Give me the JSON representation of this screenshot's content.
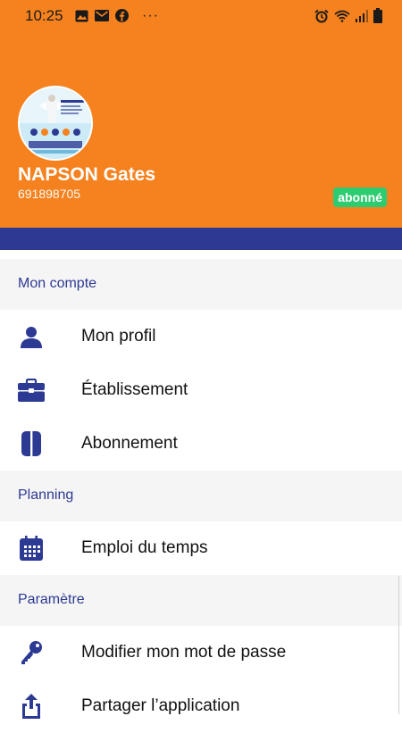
{
  "status_bar": {
    "time": "10:25",
    "more": "···",
    "left_icons": [
      "image-icon",
      "mail-icon",
      "facebook-icon"
    ],
    "right_icons": [
      "alarm-icon",
      "wifi-icon",
      "signal-icon",
      "battery-icon"
    ]
  },
  "profile": {
    "name": "NAPSON Gates",
    "phone": "691898705",
    "badge": "abonné"
  },
  "colors": {
    "accent": "#f5821f",
    "primary": "#2d3a93",
    "badge": "#2ecc71"
  },
  "menu": {
    "account": {
      "title": "Mon compte",
      "items": [
        {
          "label": "Mon profil",
          "icon": "person-icon"
        },
        {
          "label": "Établissement",
          "icon": "briefcase-icon"
        },
        {
          "label": "Abonnement",
          "icon": "card-icon"
        }
      ]
    },
    "planning": {
      "title": "Planning",
      "items": [
        {
          "label": "Emploi du temps",
          "icon": "calendar-icon"
        }
      ]
    },
    "settings": {
      "title": "Paramètre",
      "items": [
        {
          "label": "Modifier mon mot de passe",
          "icon": "key-icon"
        },
        {
          "label": "Partager l’application",
          "icon": "share-icon"
        }
      ]
    }
  }
}
